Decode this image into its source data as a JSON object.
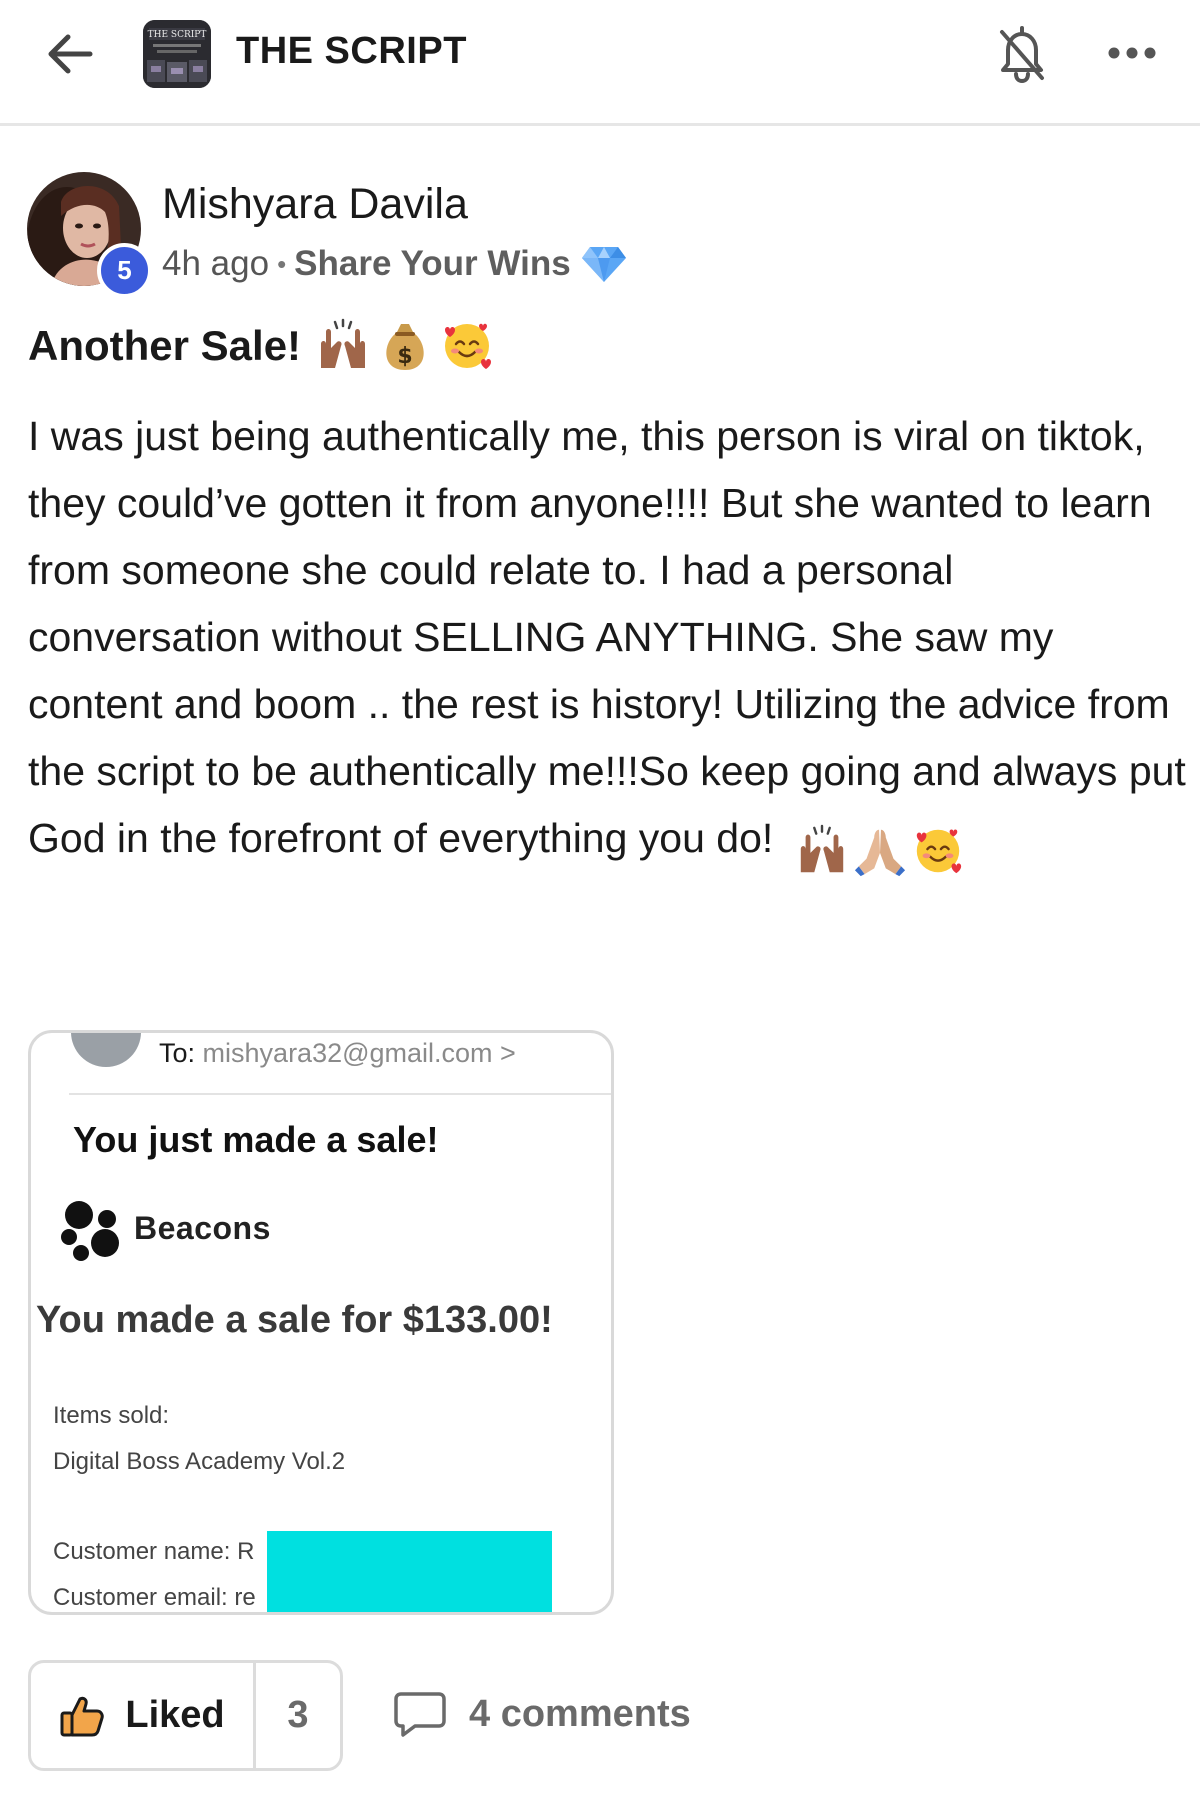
{
  "header": {
    "group_name": "THE SCRIPT",
    "logo_text": "THE SCRIPT"
  },
  "post": {
    "author": {
      "name": "Mishyara Davila",
      "level": "5"
    },
    "time": "4h ago",
    "separator": "•",
    "category": "Share Your Wins",
    "title": "Another Sale!",
    "title_emojis": [
      "raising-hands",
      "money-bag",
      "smiling-face-with-hearts"
    ],
    "body": "I was just being authentically me, this person is viral on tiktok, they could’ve gotten it from anyone!!!! But she wanted to learn from someone she could relate to. I had a personal conversation without SELLING ANYTHING. She saw my content and boom .. the rest is history! Utilizing the advice from the script to be authentically me!!!So keep going and always put God in the forefront of everything you do!",
    "body_emojis": [
      "raising-hands",
      "folded-hands",
      "smiling-face-with-hearts"
    ]
  },
  "attachment": {
    "to_label": "To:",
    "to_address": "mishyara32@gmail.com >",
    "headline": "You just made a sale!",
    "brand": "Beacons",
    "sale_text": "You made a sale for $133.00!",
    "items_label": "Items sold:",
    "items_value": "Digital Boss Academy Vol.2",
    "customer_name": "Customer name: R",
    "customer_email": "Customer email: re",
    "redaction_color": "#00e0e0"
  },
  "actions": {
    "like_label": "Liked",
    "like_count": "3",
    "comments_label": "4 comments"
  },
  "colors": {
    "badge": "#3b5bdb",
    "divider": "#e6e6e6",
    "muted_text": "#6a6a6a"
  }
}
